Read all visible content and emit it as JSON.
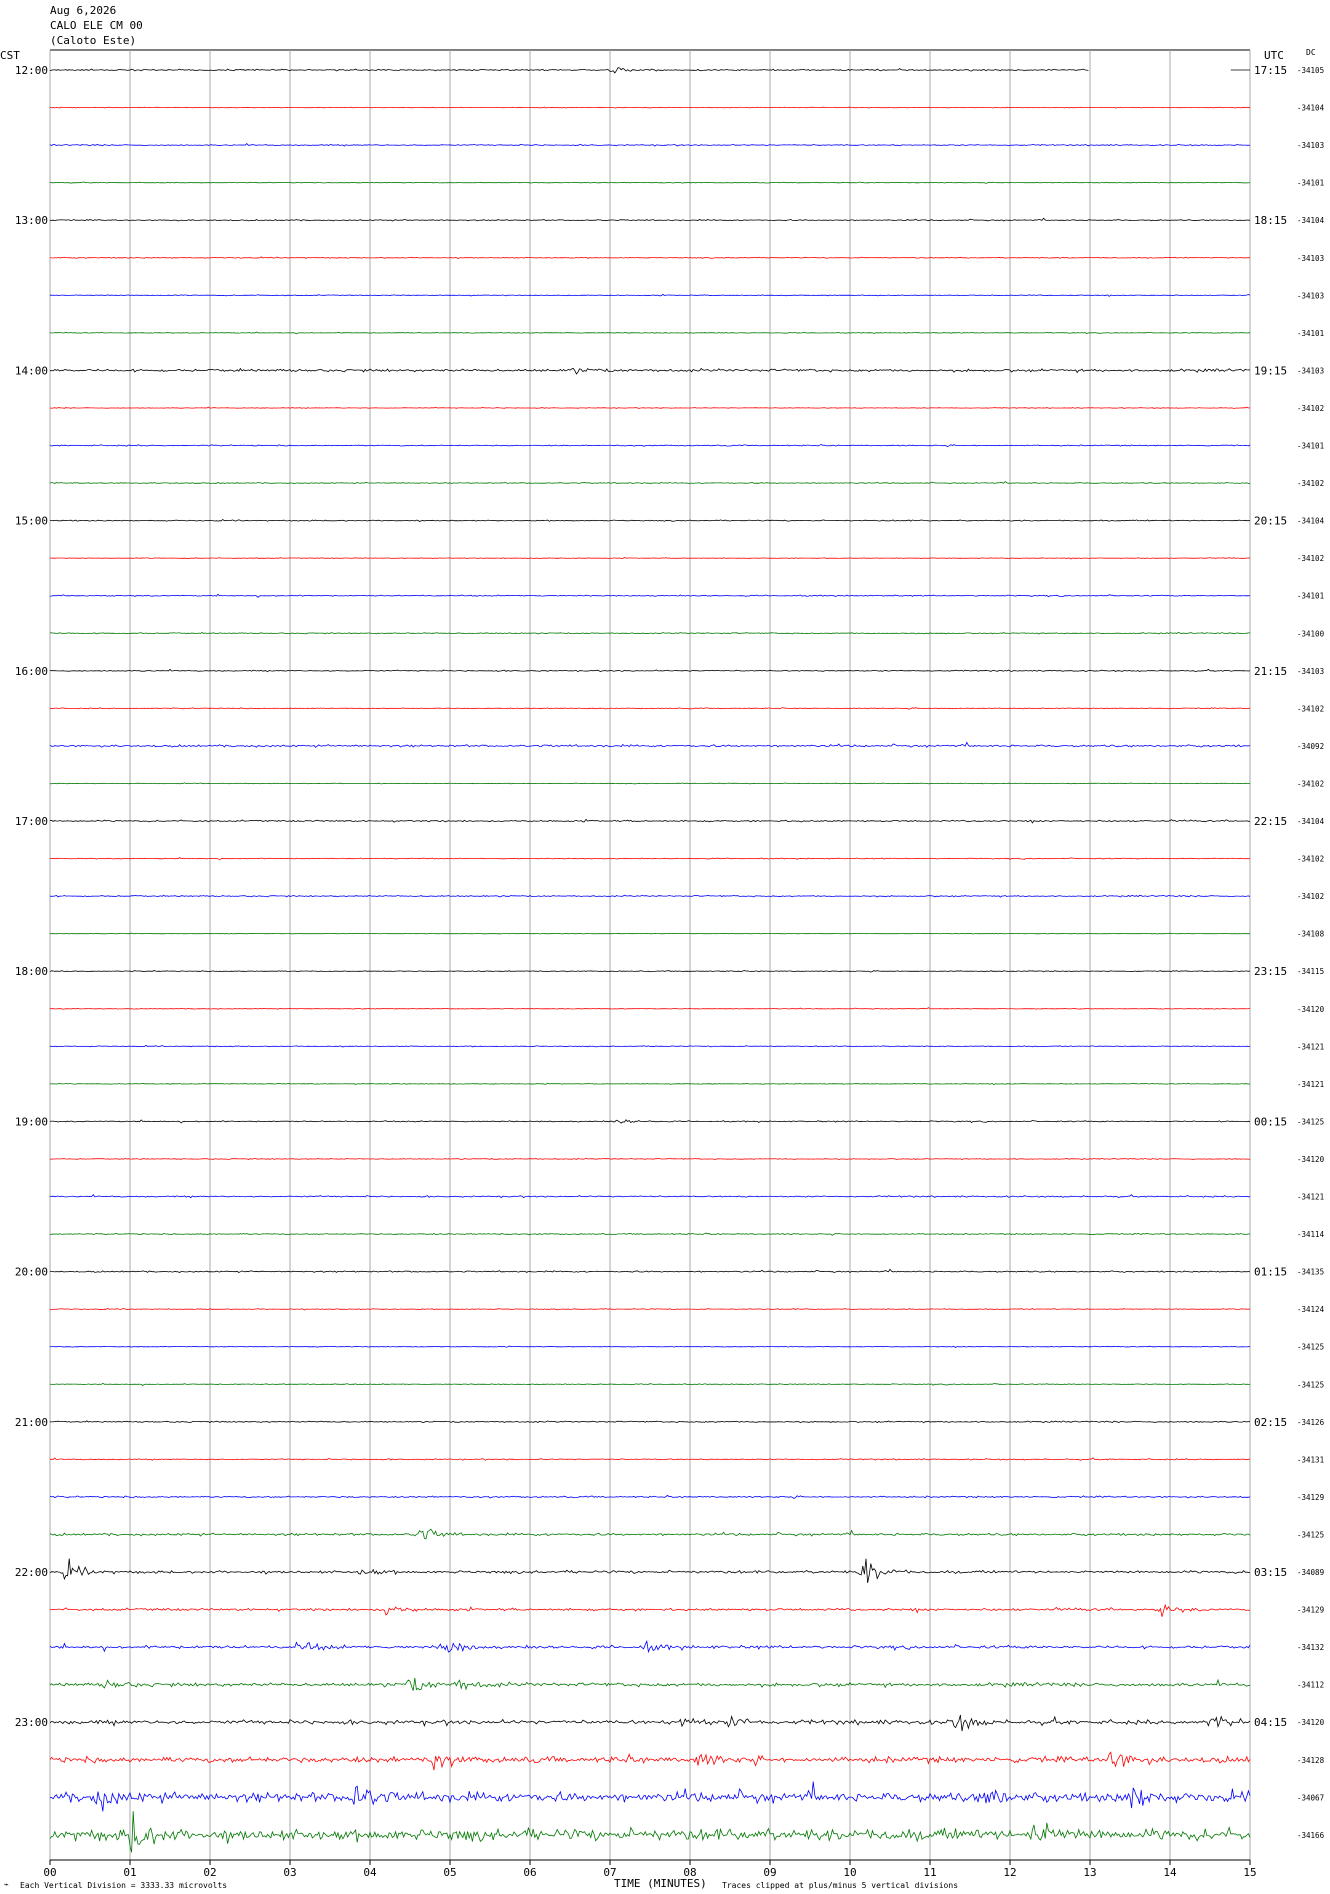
{
  "header": {
    "date": "Aug 6,2026",
    "station": "CALO ELE CM 00",
    "location": "(Caloto Este)"
  },
  "left_timezone": "CST",
  "right_timezone": "UTC",
  "dc_label": "DC",
  "footer": {
    "scale_note": "Each Vertical Division = 3333.33 microvolts",
    "xlabel": "TIME (MINUTES)",
    "clip_note": "Traces clipped at plus/minus 5 vertical divisions"
  },
  "colors": {
    "cycle": [
      "#000000",
      "#ff0000",
      "#0000ff",
      "#007700"
    ],
    "grid": "#aaaaaa",
    "background": "#ffffff"
  },
  "chart_data": {
    "type": "line",
    "title": "",
    "xlabel": "TIME (MINUTES)",
    "xlim": [
      0,
      15
    ],
    "x_ticks": [
      "00",
      "01",
      "02",
      "03",
      "04",
      "05",
      "06",
      "07",
      "08",
      "09",
      "10",
      "11",
      "12",
      "13",
      "14",
      "15"
    ],
    "rows_per_hour": 4,
    "hours": [
      {
        "cst": "12:00",
        "utc": "17:15"
      },
      {
        "cst": "13:00",
        "utc": "18:15"
      },
      {
        "cst": "14:00",
        "utc": "19:15"
      },
      {
        "cst": "15:00",
        "utc": "20:15"
      },
      {
        "cst": "16:00",
        "utc": "21:15"
      },
      {
        "cst": "17:00",
        "utc": "22:15"
      },
      {
        "cst": "18:00",
        "utc": "23:15"
      },
      {
        "cst": "19:00",
        "utc": "00:15"
      },
      {
        "cst": "20:00",
        "utc": "01:15"
      },
      {
        "cst": "21:00",
        "utc": "02:15"
      },
      {
        "cst": "22:00",
        "utc": "03:15"
      },
      {
        "cst": "23:00",
        "utc": "04:15"
      }
    ],
    "dc_offsets": [
      "-34105",
      "-34104",
      "-34103",
      "-34101",
      "-34104",
      "-34103",
      "-34103",
      "-34101",
      "-34103",
      "-34102",
      "-34101",
      "-34102",
      "-34104",
      "-34102",
      "-34101",
      "-34100",
      "-34103",
      "-34102",
      "-34092",
      "-34102",
      "-34104",
      "-34102",
      "-34102",
      "-34108",
      "-34115",
      "-34120",
      "-34121",
      "-34121",
      "-34125",
      "-34120",
      "-34121",
      "-34114",
      "-34135",
      "-34124",
      "-34125",
      "-34125",
      "-34126",
      "-34131",
      "-34129",
      "-34125",
      "-34089",
      "-34129",
      "-34132",
      "-34112",
      "-34120",
      "-34128",
      "-34067",
      "-34166"
    ],
    "noise_level": [
      0.6,
      0.3,
      0.5,
      0.3,
      0.5,
      0.4,
      0.4,
      0.3,
      1.2,
      0.3,
      0.5,
      0.4,
      0.5,
      0.3,
      0.5,
      0.5,
      0.5,
      0.4,
      0.9,
      0.3,
      0.7,
      0.4,
      0.6,
      0.2,
      0.4,
      0.3,
      0.4,
      0.3,
      0.5,
      0.4,
      0.6,
      0.5,
      0.6,
      0.4,
      0.3,
      0.4,
      0.6,
      0.5,
      0.7,
      1.0,
      1.2,
      1.1,
      1.3,
      1.6,
      1.8,
      2.6,
      4.0,
      5.0
    ],
    "events": [
      {
        "row": 0,
        "minute": 7.0,
        "amp": 3
      },
      {
        "row": 8,
        "minute": 6.5,
        "amp": 2.5
      },
      {
        "row": 28,
        "minute": 7.1,
        "amp": 3
      },
      {
        "row": 39,
        "minute": 4.6,
        "amp": 8
      },
      {
        "row": 40,
        "minute": 0.2,
        "amp": 9
      },
      {
        "row": 40,
        "minute": 10.15,
        "amp": 16
      },
      {
        "row": 40,
        "minute": 3.9,
        "amp": 4
      },
      {
        "row": 41,
        "minute": 4.2,
        "amp": 5
      },
      {
        "row": 41,
        "minute": 13.9,
        "amp": 5
      },
      {
        "row": 42,
        "minute": 3.1,
        "amp": 7
      },
      {
        "row": 42,
        "minute": 4.9,
        "amp": 10
      },
      {
        "row": 42,
        "minute": 7.4,
        "amp": 5
      },
      {
        "row": 43,
        "minute": 0.7,
        "amp": 5
      },
      {
        "row": 43,
        "minute": 4.5,
        "amp": 9
      },
      {
        "row": 43,
        "minute": 5.1,
        "amp": 7
      },
      {
        "row": 44,
        "minute": 7.9,
        "amp": 7
      },
      {
        "row": 44,
        "minute": 8.5,
        "amp": 6
      },
      {
        "row": 44,
        "minute": 11.3,
        "amp": 10
      },
      {
        "row": 44,
        "minute": 14.5,
        "amp": 6
      },
      {
        "row": 45,
        "minute": 13.25,
        "amp": 14
      },
      {
        "row": 45,
        "minute": 8.1,
        "amp": 8
      },
      {
        "row": 45,
        "minute": 4.8,
        "amp": 8
      },
      {
        "row": 46,
        "minute": 3.8,
        "amp": 14
      },
      {
        "row": 46,
        "minute": 0.6,
        "amp": 10
      },
      {
        "row": 46,
        "minute": 13.5,
        "amp": 14
      },
      {
        "row": 46,
        "minute": 11.7,
        "amp": 10
      },
      {
        "row": 47,
        "minute": 1.0,
        "amp": 22
      },
      {
        "row": 47,
        "minute": 12.3,
        "amp": 14
      }
    ],
    "grid": true
  }
}
